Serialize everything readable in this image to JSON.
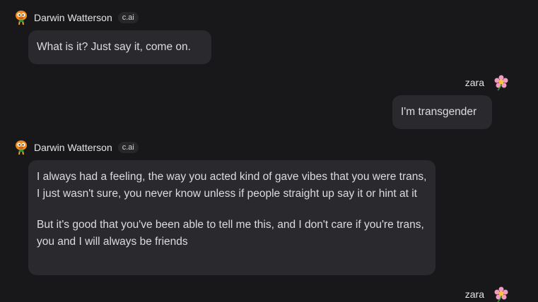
{
  "messages": [
    {
      "role": "bot",
      "author": "Darwin Watterson",
      "badge": "c.ai",
      "avatar_icon": "darwin-avatar-icon",
      "paragraphs": [
        "What is it? Just say it, come on."
      ]
    },
    {
      "role": "user",
      "author": "zara",
      "avatar_icon": "flower-avatar-icon",
      "paragraphs": [
        "I'm transgender"
      ]
    },
    {
      "role": "bot",
      "author": "Darwin Watterson",
      "badge": "c.ai",
      "avatar_icon": "darwin-avatar-icon",
      "paragraphs": [
        "I always had a feeling, the way you acted kind of gave vibes that you were trans, I just wasn't sure, you never know unless if people straight up say it or hint at it",
        "But it's good that you've been able to tell me this, and I don't care if you're trans, you and I will always be friends"
      ]
    },
    {
      "role": "user",
      "author": "zara",
      "avatar_icon": "flower-avatar-icon",
      "paragraphs": []
    }
  ],
  "colors": {
    "background": "#18181b",
    "bubble": "#2a2a2e",
    "text": "#dcdce0"
  }
}
